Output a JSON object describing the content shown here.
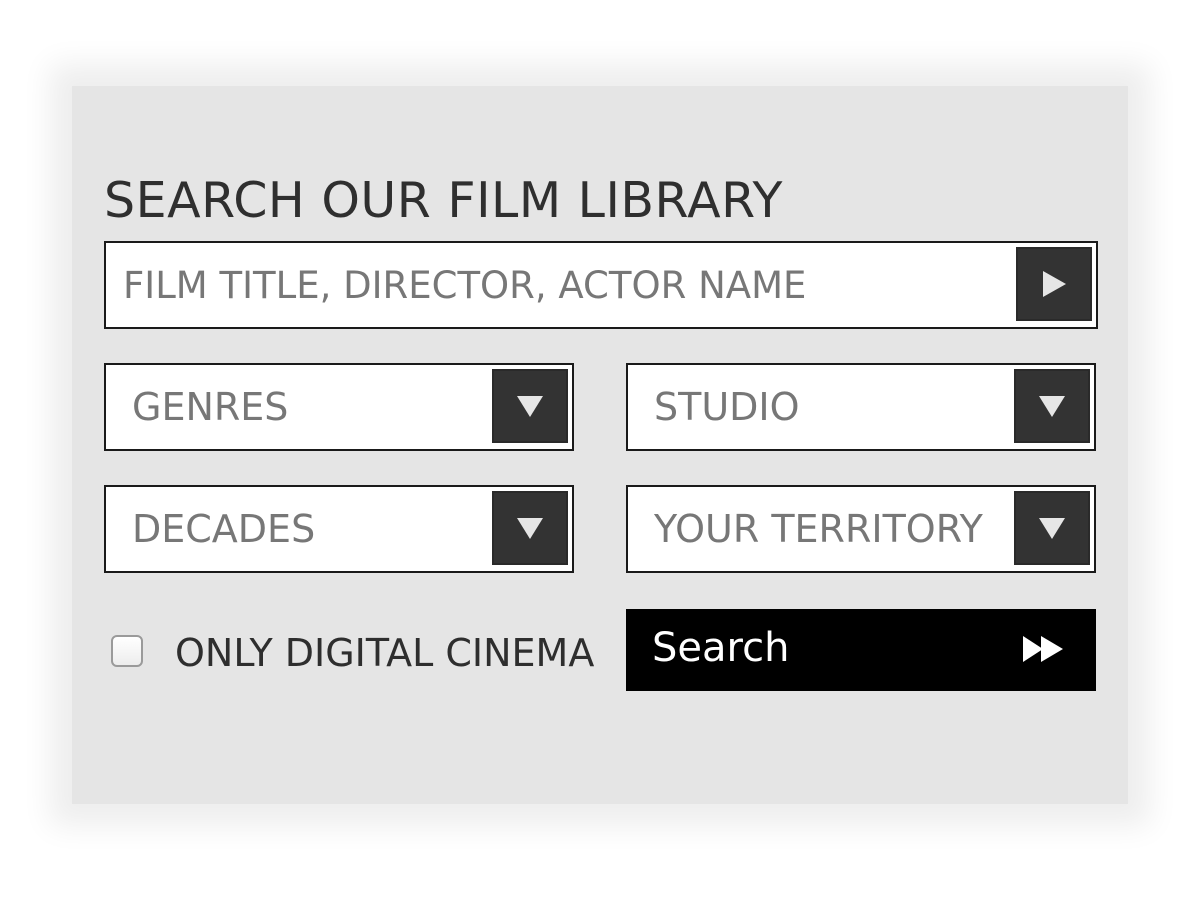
{
  "form": {
    "title": "SEARCH OUR FILM LIBRARY",
    "keyword": {
      "placeholder": "FILM TITLE, DIRECTOR, ACTOR NAME",
      "value": "",
      "button_icon": "play-icon"
    },
    "dropdowns": {
      "genres": {
        "selected": "GENRES",
        "icon": "triangle-down-icon"
      },
      "studio": {
        "selected": "STUDIO",
        "icon": "triangle-down-icon"
      },
      "decades": {
        "selected": "DECADES",
        "icon": "triangle-down-icon"
      },
      "territory": {
        "selected": "YOUR TERRITORY",
        "icon": "triangle-down-icon"
      }
    },
    "digital_cinema": {
      "label": "ONLY DIGITAL CINEMA",
      "checked": false
    },
    "search_button": {
      "label": "Search",
      "icon": "fast-forward-icon"
    }
  },
  "colors": {
    "panel_background": "#e5e5e5",
    "dropdown_button": "#333333",
    "search_button": "#000000",
    "title_text": "#2f2f2f",
    "placeholder_text": "#777777"
  }
}
